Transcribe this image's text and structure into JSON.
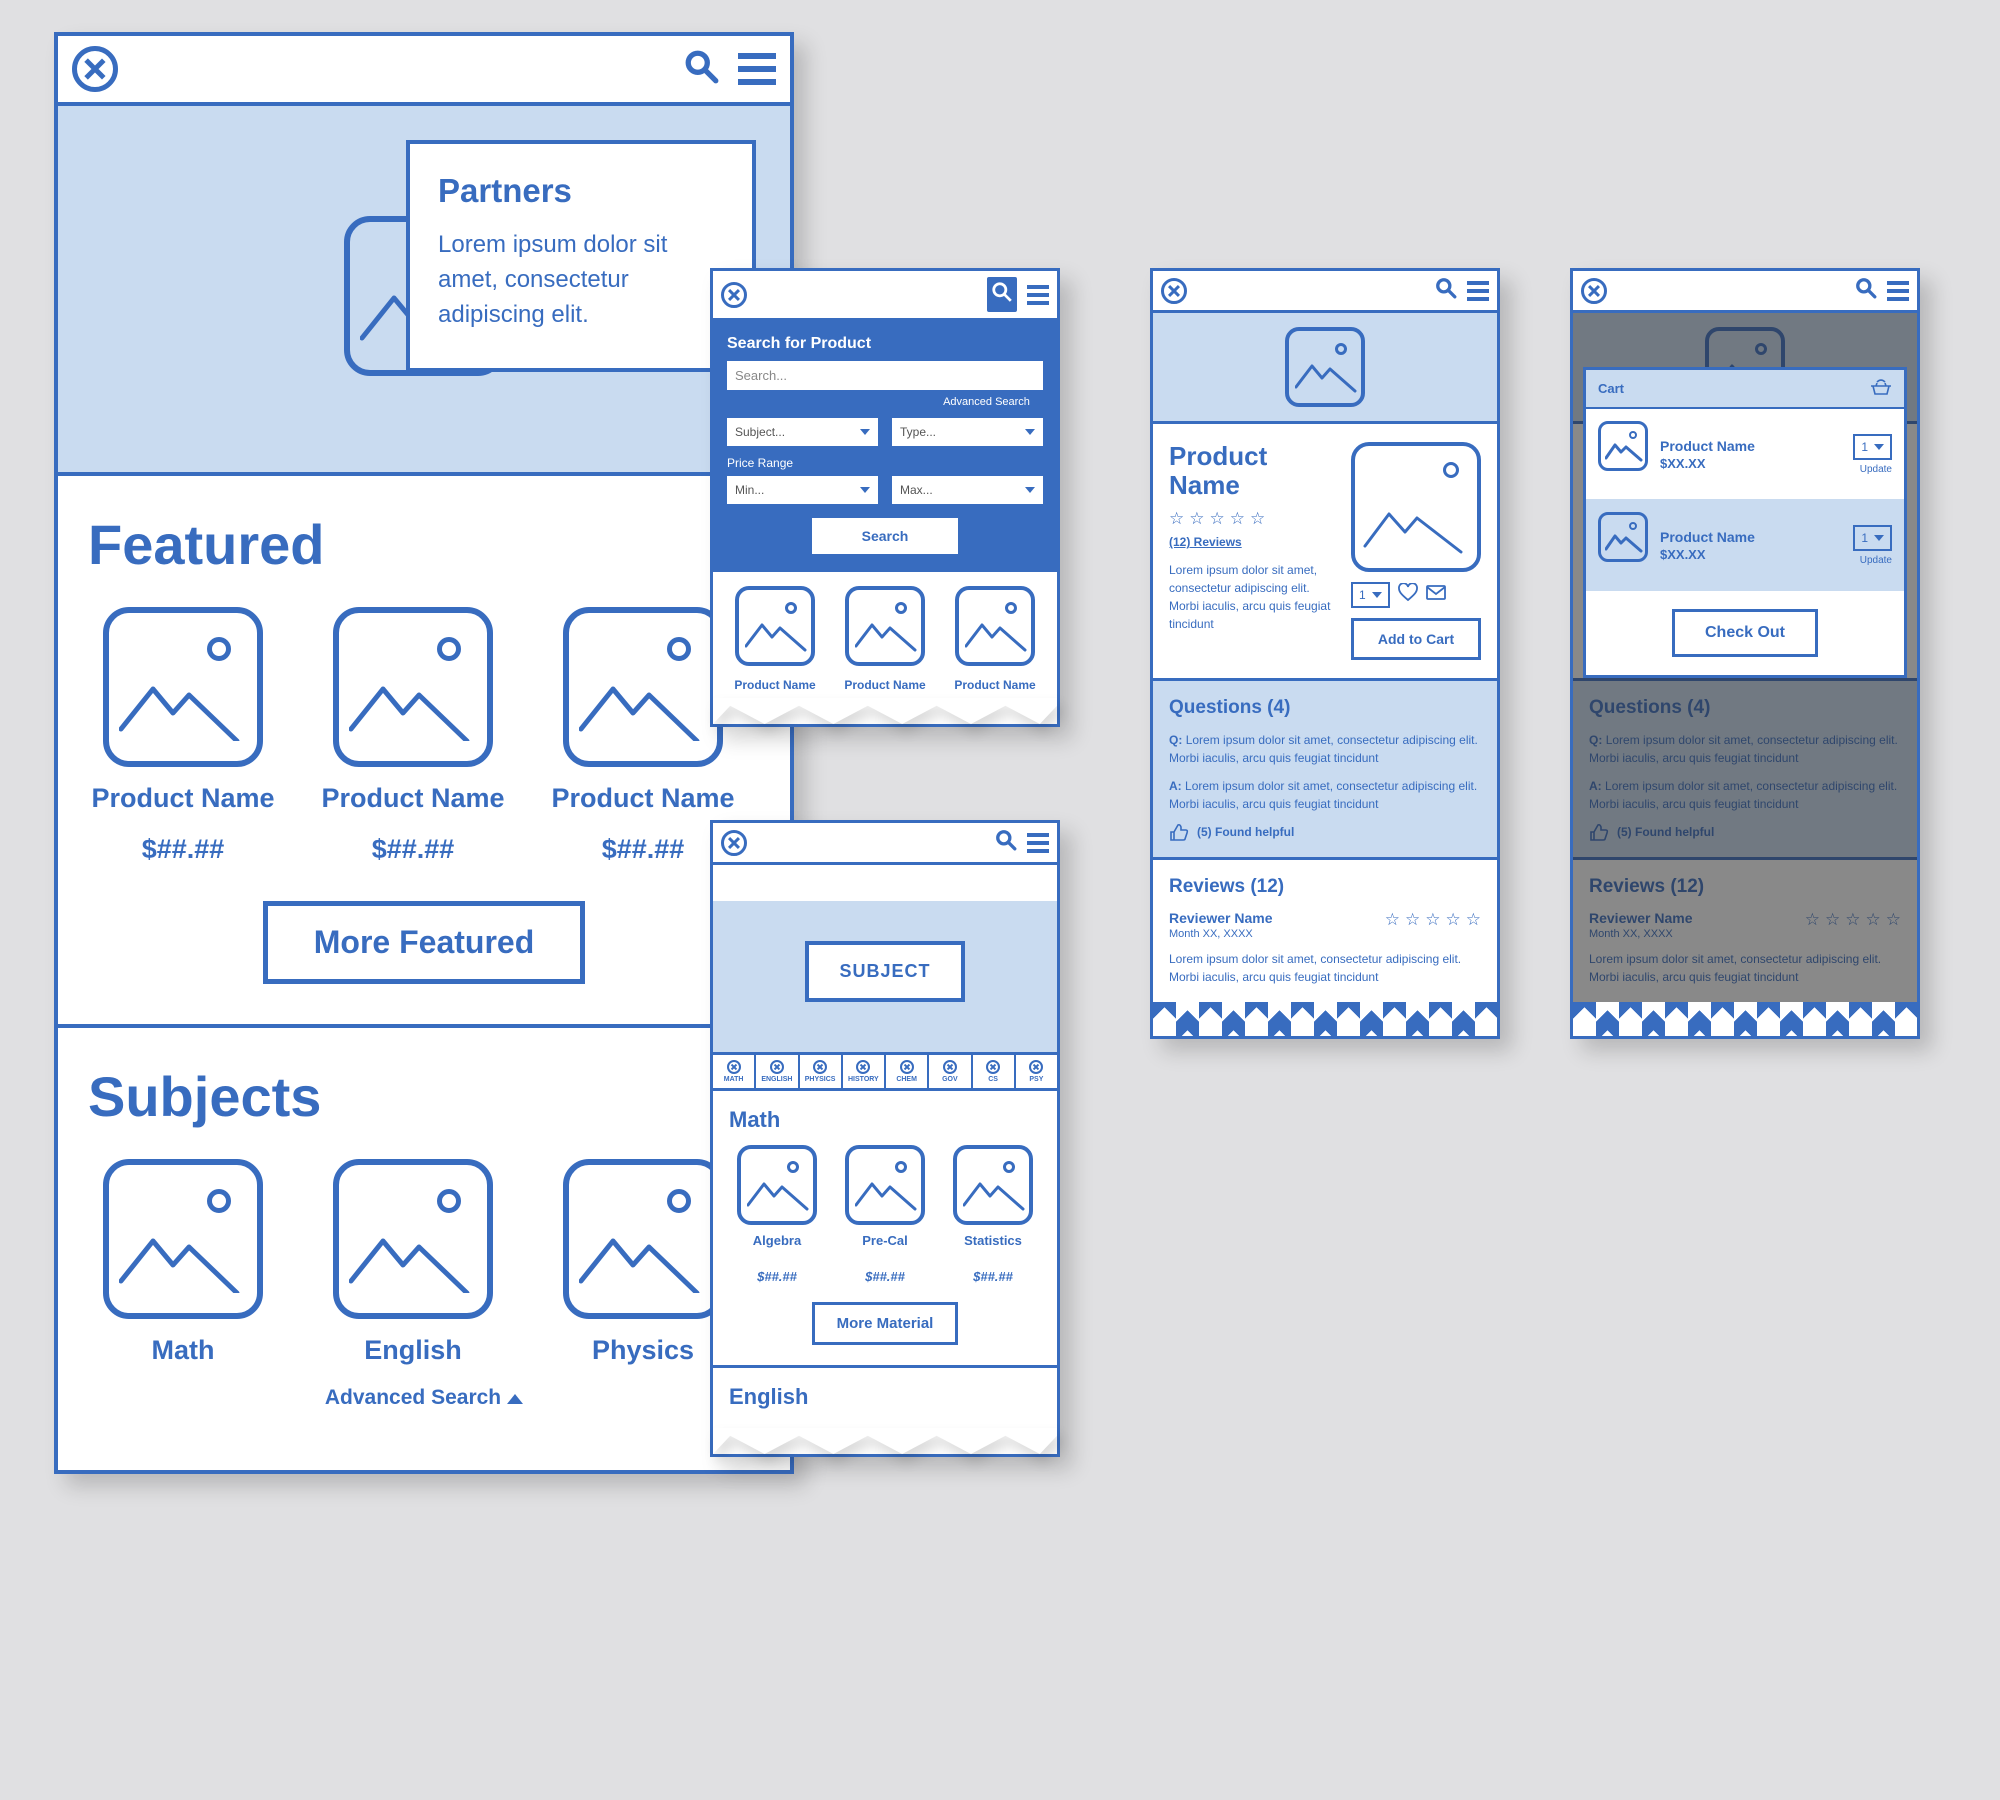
{
  "home": {
    "partners_title": "Partners",
    "partners_body": "Lorem ipsum dolor sit amet, consectetur adipiscing elit.",
    "featured_title": "Featured",
    "product_name": "Product Name",
    "product_price": "$##.##",
    "more_featured": "More Featured",
    "subjects_title": "Subjects",
    "subjects": [
      "Math",
      "English",
      "Physics"
    ],
    "advanced_search": "Advanced Search"
  },
  "search": {
    "title": "Search for Product",
    "placeholder": "Search...",
    "advanced": "Advanced Search",
    "subject": "Subject...",
    "type": "Type...",
    "price_range": "Price Range",
    "min": "Min...",
    "max": "Max...",
    "button": "Search",
    "result_name": "Product Name"
  },
  "subject_page": {
    "hero_button": "SUBJECT",
    "tabs": [
      "MATH",
      "ENGLISH",
      "PHYSICS",
      "HISTORY",
      "CHEM",
      "GOV",
      "CS",
      "PSY"
    ],
    "math_title": "Math",
    "items": [
      "Algebra",
      "Pre-Cal",
      "Statistics"
    ],
    "item_price": "$##.##",
    "more": "More Material",
    "english_title": "English"
  },
  "product": {
    "title": "Product Name",
    "reviews_link": "(12) Reviews",
    "body": "Lorem ipsum dolor sit amet, consectetur adipiscing elit. Morbi iaculis, arcu quis feugiat tincidunt",
    "qty": "1",
    "add_to_cart": "Add to Cart",
    "questions_title": "Questions (4)",
    "q": "Q: Lorem ipsum dolor sit amet, consectetur adipiscing elit. Morbi iaculis, arcu quis feugiat tincidunt",
    "a": "A: Lorem ipsum dolor sit amet, consectetur adipiscing elit. Morbi iaculis, arcu quis feugiat tincidunt",
    "helpful": "(5) Found helpful",
    "reviews_title": "Reviews (12)",
    "reviewer": "Reviewer Name",
    "review_date": "Month XX, XXXX",
    "review_body": "Lorem ipsum dolor sit amet, consectetur adipiscing elit. Morbi iaculis, arcu quis feugiat tincidunt"
  },
  "cart": {
    "title": "Cart",
    "item_name": "Product Name",
    "item_price": "$XX.XX",
    "qty": "1",
    "update": "Update",
    "checkout": "Check Out"
  }
}
